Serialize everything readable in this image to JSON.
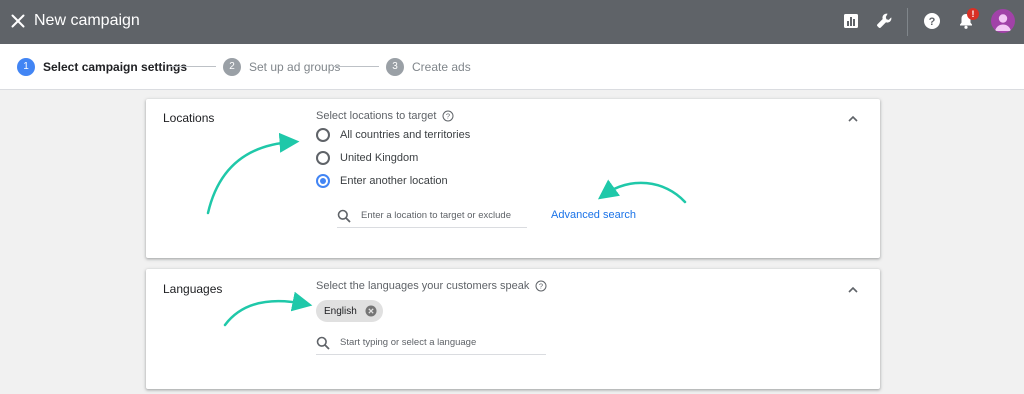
{
  "header": {
    "title": "New campaign",
    "icons": [
      "close-icon",
      "reports-icon",
      "tools-icon",
      "help-icon",
      "notifications-icon",
      "account-avatar"
    ],
    "notification_badge": "!",
    "colors": {
      "bar": "#5f6368",
      "badge": "#d93025",
      "avatar": "#a142a8"
    }
  },
  "stepper": {
    "steps": [
      {
        "number": "1",
        "label": "Select campaign settings",
        "state": "active"
      },
      {
        "number": "2",
        "label": "Set up ad groups",
        "state": "upcoming"
      },
      {
        "number": "3",
        "label": "Create ads",
        "state": "upcoming"
      }
    ],
    "colors": {
      "active": "#4285f4",
      "upcoming": "#9aa0a6"
    }
  },
  "locations": {
    "title": "Locations",
    "prompt": "Select locations to target",
    "options": [
      {
        "label": "All countries and territories",
        "selected": false
      },
      {
        "label": "United Kingdom",
        "selected": false
      },
      {
        "label": "Enter another location",
        "selected": true
      }
    ],
    "search_placeholder": "Enter a location to target or exclude",
    "advanced_link": "Advanced search"
  },
  "languages": {
    "title": "Languages",
    "prompt": "Select the languages your customers speak",
    "selected_chip": "English",
    "search_placeholder": "Start typing or select a language"
  },
  "annotation_color": "#1fc8a9"
}
